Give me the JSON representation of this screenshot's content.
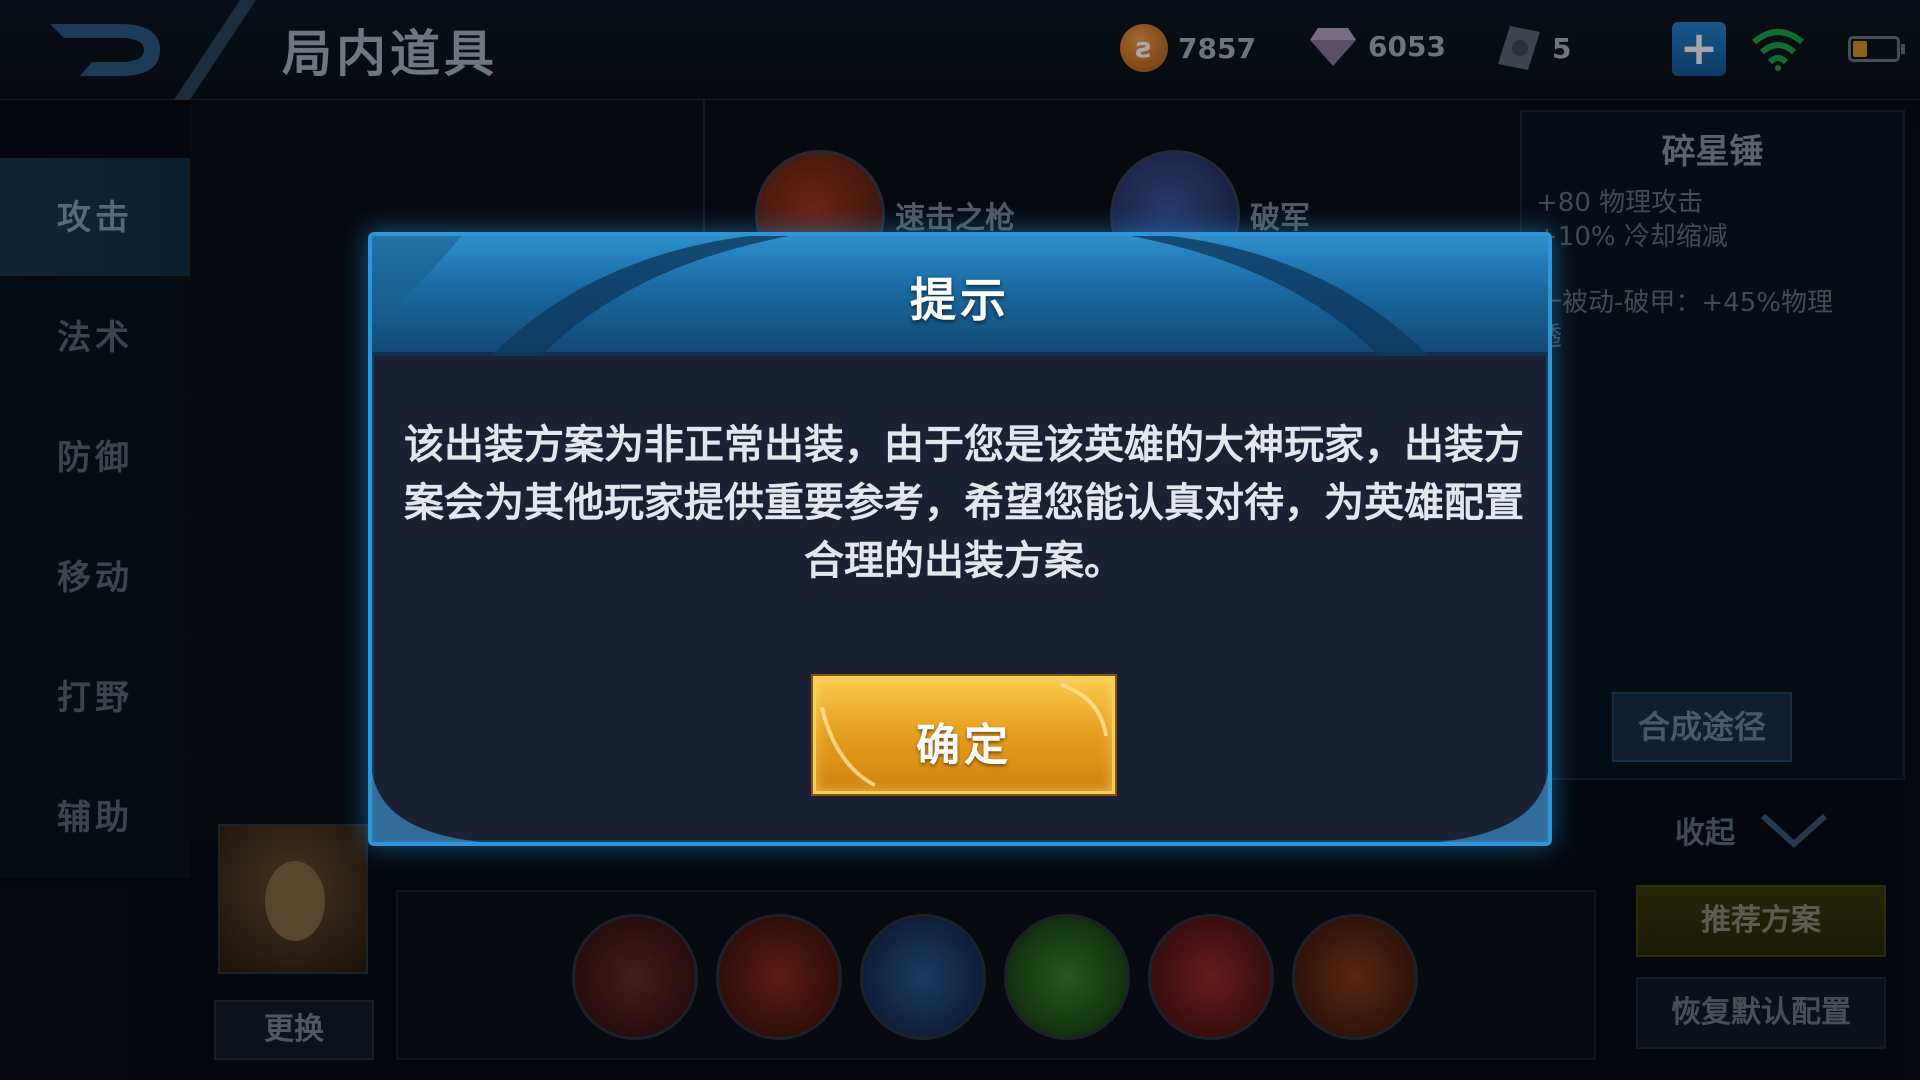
{
  "header": {
    "title": "局内道具",
    "currencies": [
      {
        "icon": "gold-coin-icon",
        "value": "7857"
      },
      {
        "icon": "diamond-icon",
        "value": "6053"
      },
      {
        "icon": "ticket-icon",
        "value": "5"
      }
    ]
  },
  "sidebar": {
    "items": [
      {
        "label": "攻击",
        "active": true
      },
      {
        "label": "法术",
        "active": false
      },
      {
        "label": "防御",
        "active": false
      },
      {
        "label": "移动",
        "active": false
      },
      {
        "label": "打野",
        "active": false
      },
      {
        "label": "辅助",
        "active": false
      }
    ]
  },
  "items": [
    {
      "name": "速击之枪",
      "icon": "spear-icon"
    },
    {
      "name": "破军",
      "icon": "sword-icon"
    }
  ],
  "detail": {
    "title": "碎星锤",
    "stat1": "+80 物理攻击",
    "stat2": "+10% 冷却缩减",
    "passive": "一被动-破甲：+45%物理",
    "passive2": "透",
    "combo_label": "合成途径"
  },
  "right_buttons": {
    "collapse": "收起",
    "recommend": "推荐方案",
    "reset": "恢复默认配置"
  },
  "hero": {
    "change_label": "更换"
  },
  "dialog": {
    "title": "提示",
    "body": "该出装方案为非正常出装，由于您是该英雄的大神玩家，出装方案会为其他玩家提供重要参考，希望您能认真对待，为英雄配置合理的出装方案。",
    "confirm": "确定"
  },
  "colors": {
    "dialog_border": "#2f95d6",
    "dialog_header": "#1a6aa2",
    "dialog_bg": "#1a2132",
    "confirm_button": "#e49a1c"
  }
}
